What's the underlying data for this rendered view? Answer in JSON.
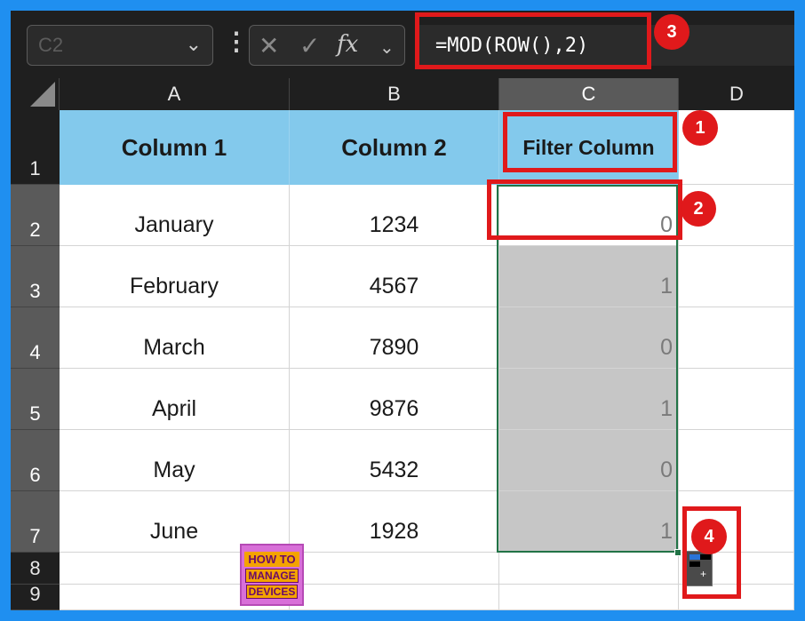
{
  "formula_bar": {
    "name_box": "C2",
    "formula": "=MOD(ROW(),2)"
  },
  "columns": [
    "A",
    "B",
    "C",
    "D"
  ],
  "rows": [
    "1",
    "2",
    "3",
    "4",
    "5",
    "6",
    "7",
    "8",
    "9"
  ],
  "table": {
    "headers": [
      "Column 1",
      "Column 2",
      "Filter Column"
    ],
    "data": [
      [
        "January",
        "1234",
        "0"
      ],
      [
        "February",
        "4567",
        "1"
      ],
      [
        "March",
        "7890",
        "0"
      ],
      [
        "April",
        "9876",
        "1"
      ],
      [
        "May",
        "5432",
        "0"
      ],
      [
        "June",
        "1928",
        "1"
      ]
    ]
  },
  "callouts": [
    "1",
    "2",
    "3",
    "4"
  ],
  "logo": {
    "line1": "HOW TO",
    "line2": "MANAGE",
    "line3": "DEVICES"
  },
  "colors": {
    "header_fill": "#83c9ec",
    "selection": "#217346",
    "callout": "#e0191b",
    "outer_frame": "#1f8ff0"
  }
}
